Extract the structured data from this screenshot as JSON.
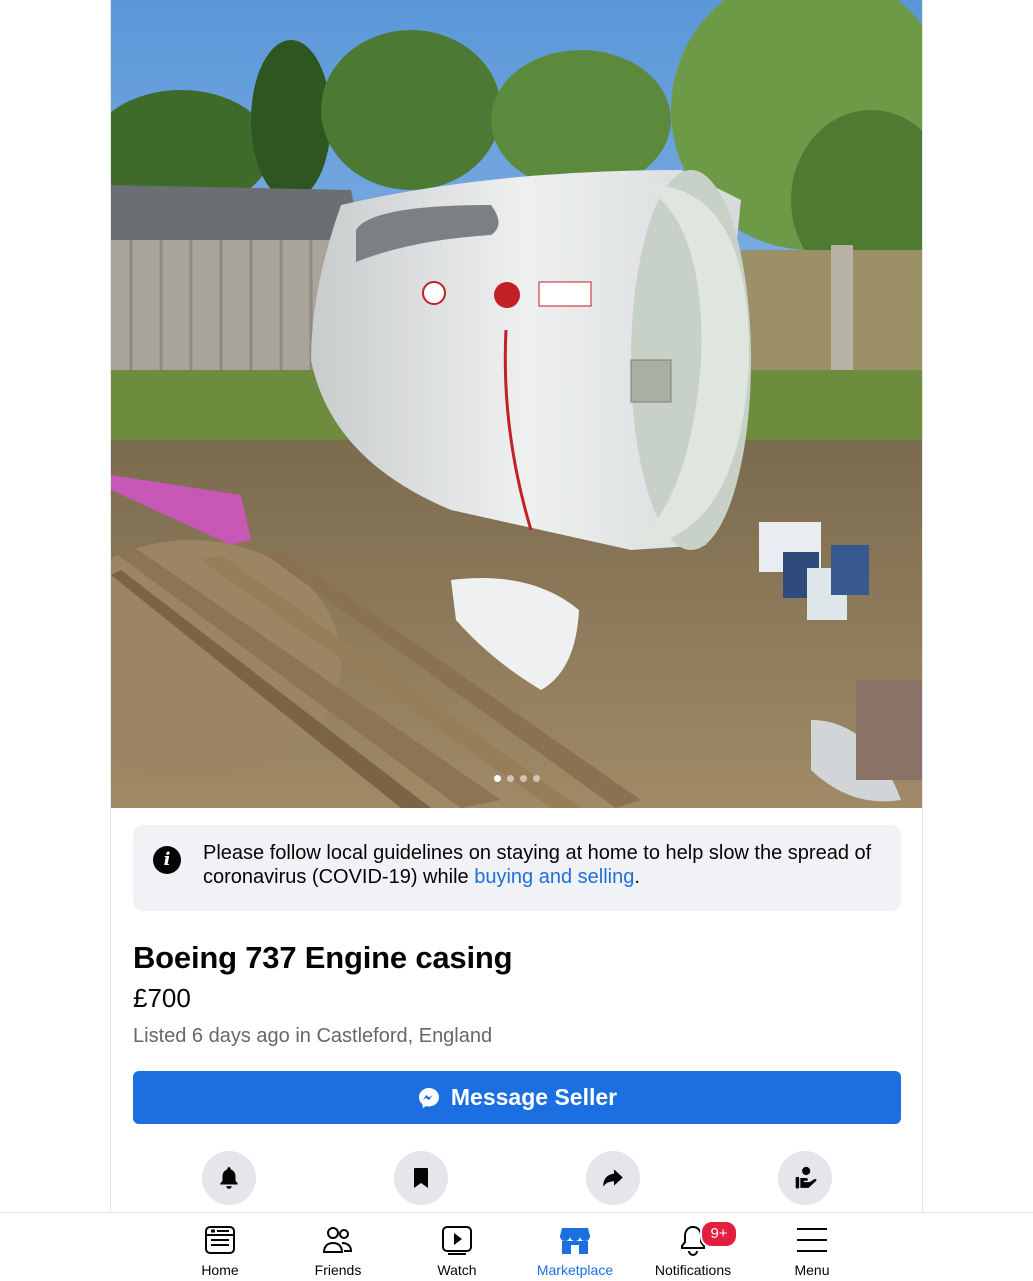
{
  "photo": {
    "image_count": 4,
    "active_index": 0
  },
  "notice": {
    "text": "Please follow local guidelines on staying at home to help slow the spread of coronavirus (COVID-19) while ",
    "link": "buying and selling",
    "end": "."
  },
  "listing": {
    "title": "Boeing 737 Engine casing",
    "price": "£700",
    "listed": "Listed 6 days ago in Castleford, England"
  },
  "message_button": {
    "label": "Message Seller",
    "icon": "messenger-icon"
  },
  "actions": [
    {
      "icon": "bell-icon"
    },
    {
      "icon": "bookmark-icon"
    },
    {
      "icon": "share-icon"
    },
    {
      "icon": "seller-profile-icon"
    }
  ],
  "tabbar": {
    "active": "Marketplace",
    "accent": "#1b6fe0",
    "items": [
      {
        "label": "Home",
        "icon": "home-icon"
      },
      {
        "label": "Friends",
        "icon": "friends-icon"
      },
      {
        "label": "Watch",
        "icon": "watch-icon"
      },
      {
        "label": "Marketplace",
        "icon": "marketplace-icon"
      },
      {
        "label": "Notifications",
        "icon": "bell-icon",
        "badge": "9+"
      },
      {
        "label": "Menu",
        "icon": "menu-icon"
      }
    ]
  },
  "colors": {
    "brand_blue": "#1b6fe0",
    "badge_red": "#e41e3f",
    "link_blue": "#216fdb"
  }
}
